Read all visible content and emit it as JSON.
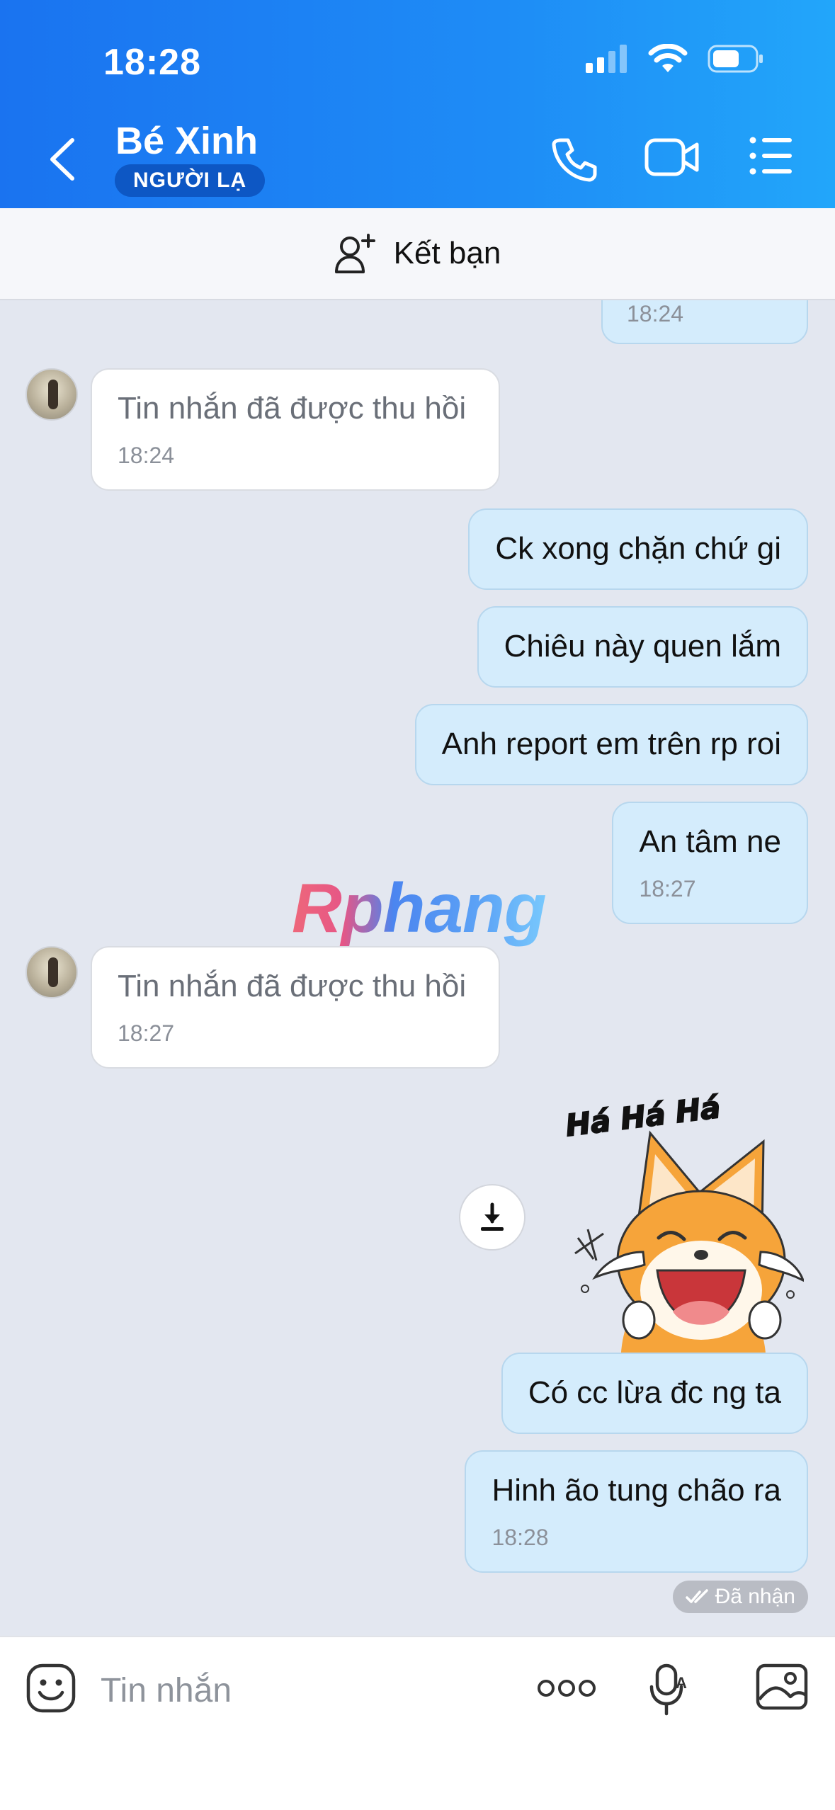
{
  "status_bar": {
    "time": "18:28"
  },
  "header": {
    "title": "Bé Xinh",
    "badge": "NGƯỜI LẠ",
    "icons": [
      "back-arrow-icon",
      "phone-icon",
      "video-call-icon",
      "menu-list-icon"
    ]
  },
  "friend_bar": {
    "label": "Kết bạn",
    "icon": "add-friend-icon"
  },
  "watermark": "Rphang",
  "messages": [
    {
      "side": "sent",
      "text": "",
      "time": "18:24"
    },
    {
      "side": "received",
      "text": "Tin nhắn đã được thu hồi",
      "time": "18:24"
    },
    {
      "side": "sent",
      "text": "Ck xong chặn chứ gi"
    },
    {
      "side": "sent",
      "text": "Chiêu này quen lắm"
    },
    {
      "side": "sent",
      "text": "Anh report em trên rp roi"
    },
    {
      "side": "sent",
      "text": "An tâm ne",
      "time": "18:27"
    },
    {
      "side": "received",
      "text": "Tin nhắn đã được thu hồi",
      "time": "18:27"
    },
    {
      "side": "sent",
      "type": "sticker",
      "caption": "Há Há Há"
    },
    {
      "side": "sent",
      "text": "Có cc lừa đc ng ta"
    },
    {
      "side": "sent",
      "text": "Hinh ão tung chão ra",
      "time": "18:28"
    }
  ],
  "receipt": "Đã nhận",
  "input_bar": {
    "placeholder": "Tin nhắn",
    "icons": [
      "emoji-icon",
      "more-dots-icon",
      "voice-text-icon",
      "image-icon"
    ]
  },
  "colors": {
    "header_start": "#1a73f0",
    "header_end": "#22a6fa",
    "sent_bubble": "#d4ecfc",
    "chat_bg": "#e3e7f0"
  }
}
